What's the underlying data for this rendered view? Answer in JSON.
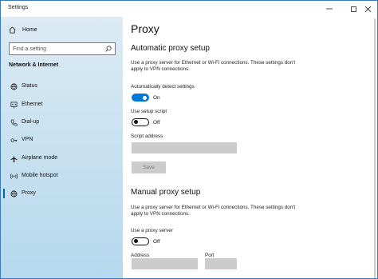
{
  "window": {
    "title": "Settings"
  },
  "sidebar": {
    "home_label": "Home",
    "search_placeholder": "Find a setting",
    "section_title": "Network & Internet",
    "items": [
      {
        "label": "Status",
        "icon": "globe-icon"
      },
      {
        "label": "Ethernet",
        "icon": "ethernet-icon"
      },
      {
        "label": "Dial-up",
        "icon": "phone-icon"
      },
      {
        "label": "VPN",
        "icon": "vpn-icon"
      },
      {
        "label": "Airplane mode",
        "icon": "airplane-icon"
      },
      {
        "label": "Mobile hotspot",
        "icon": "hotspot-icon"
      },
      {
        "label": "Proxy",
        "icon": "globe-icon",
        "active": true
      }
    ]
  },
  "main": {
    "title": "Proxy",
    "automatic": {
      "heading": "Automatic proxy setup",
      "description": "Use a proxy server for Ethernet or Wi-Fi connections. These settings don't apply to VPN connections.",
      "detect_label": "Automatically detect settings",
      "detect_state": "On",
      "script_label": "Use setup script",
      "script_state": "Off",
      "address_label": "Script address",
      "address_value": "",
      "save_label": "Save"
    },
    "manual": {
      "heading": "Manual proxy setup",
      "description": "Use a proxy server for Ethernet or Wi-Fi connections. These settings don't apply to VPN connections.",
      "proxy_label": "Use a proxy server",
      "proxy_state": "Off",
      "address_label": "Address",
      "address_value": "",
      "port_label": "Port",
      "port_value": ""
    }
  },
  "colors": {
    "accent": "#0078d7",
    "sidebar": "#c9e2f1",
    "window_border": "#3a78c2"
  }
}
